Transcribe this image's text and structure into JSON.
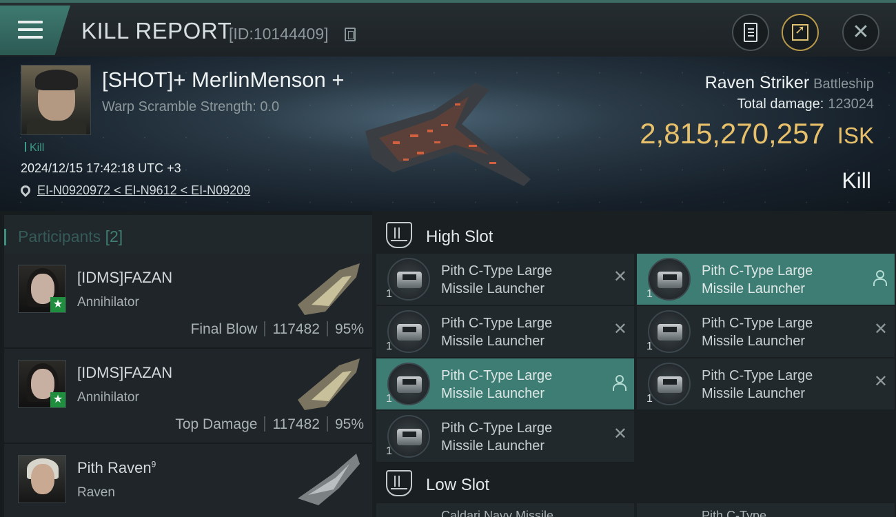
{
  "topbar": {
    "title": "KILL REPORT",
    "report_id": "[ID:10144409]",
    "icons": [
      "menu-icon",
      "copy-icon",
      "clipboard-icon",
      "share-icon",
      "close-icon"
    ]
  },
  "victim": {
    "name": "[SHOT]+ MerlinMenson +",
    "warp_scramble": "Warp Scramble Strength: 0.0",
    "tag": "Kill",
    "datetime": "2024/12/15 17:42:18 UTC +3",
    "location": "EI-N0920972 < EI-N9612 < EI-N09209",
    "ship": "Raven Striker",
    "ship_class": "Battleship",
    "total_damage_label": "Total damage:",
    "total_damage": "123024",
    "isk_value": "2,815,270,257",
    "isk_unit": "ISK",
    "result": "Kill"
  },
  "participants": {
    "title": "Participants",
    "count": "[2]",
    "rows": [
      {
        "name": "[IDMS]FAZAN",
        "ship": "Annihilator",
        "role": "Final Blow",
        "damage": "117482",
        "percent": "95%"
      },
      {
        "name": "[IDMS]FAZAN",
        "ship": "Annihilator",
        "role": "Top Damage",
        "damage": "117482",
        "percent": "95%"
      },
      {
        "name": "Pith Raven",
        "name_sup": "9",
        "ship": "Raven"
      }
    ]
  },
  "slots": {
    "high_slot": "High Slot",
    "low_slot": "Low Slot",
    "module_name_line1": "Pith C-Type Large",
    "module_name_line2": "Missile Launcher",
    "qty": "1",
    "modules": [
      {
        "status": "destroyed"
      },
      {
        "status": "dropped"
      },
      {
        "status": "destroyed"
      },
      {
        "status": "destroyed"
      },
      {
        "status": "dropped"
      },
      {
        "status": "destroyed"
      },
      {
        "status": "destroyed"
      }
    ],
    "low_peek_left": "Caldari Navy Missile",
    "low_peek_right": "Pith C-Type"
  },
  "colors": {
    "accent": "#3e8f7f",
    "isk": "#e8c06a",
    "highlight_row": "#3d7d74"
  }
}
